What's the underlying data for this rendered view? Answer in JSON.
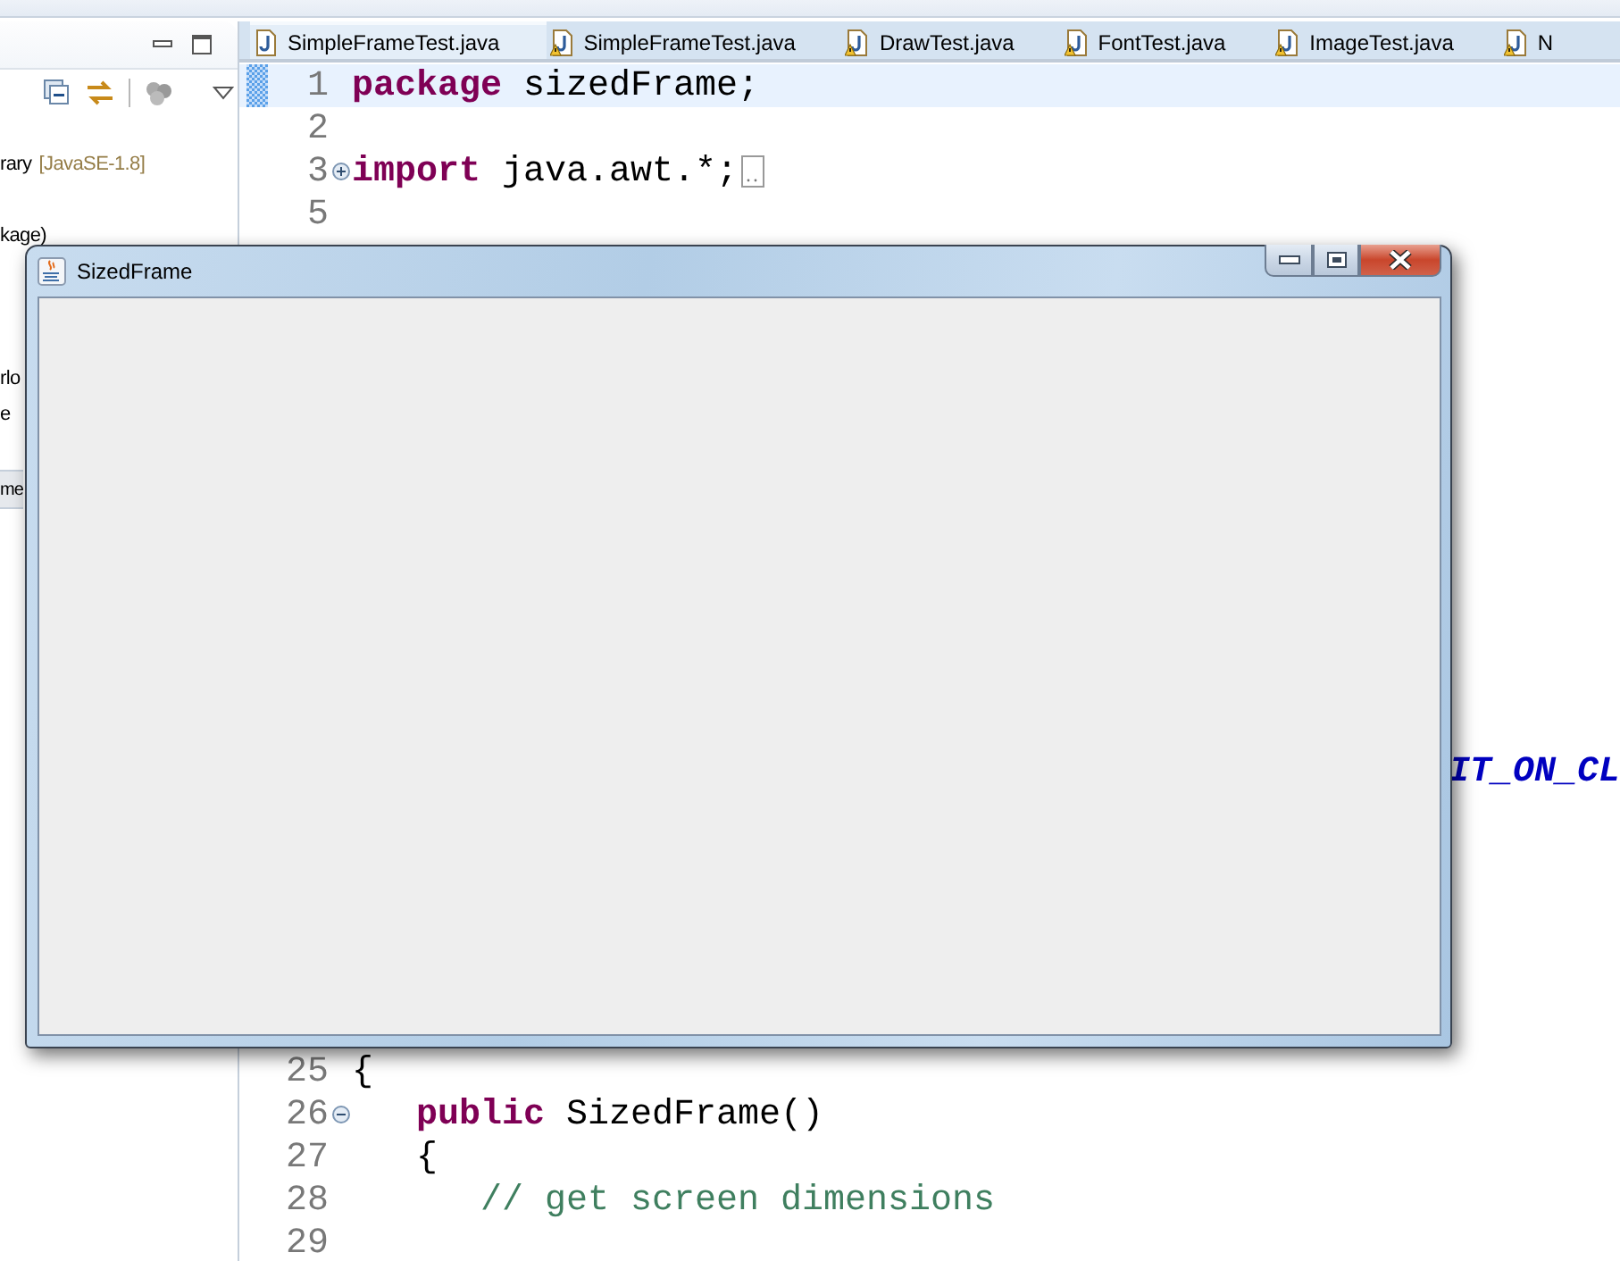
{
  "left_panel": {
    "items": [
      {
        "label": "rary",
        "decoration": "[JavaSE-1.8]"
      },
      {
        "label": "kage)"
      },
      {
        "label": "rlo"
      },
      {
        "label": "e"
      }
    ],
    "tab": {
      "label": "me"
    }
  },
  "editor": {
    "tabs": [
      {
        "label": "SimpleFrameTest.java",
        "warning": false,
        "selected": true
      },
      {
        "label": "SimpleFrameTest.java",
        "warning": true,
        "selected": false
      },
      {
        "label": "DrawTest.java",
        "warning": true,
        "selected": false
      },
      {
        "label": "FontTest.java",
        "warning": true,
        "selected": false
      },
      {
        "label": "ImageTest.java",
        "warning": true,
        "selected": false
      },
      {
        "label": "N",
        "warning": true,
        "selected": false
      }
    ],
    "lines": [
      {
        "kind": "code",
        "number": "1",
        "current": true,
        "segments": [
          {
            "kind": "keyword",
            "text": "package"
          },
          {
            "kind": "plain",
            "text": " sizedFrame;"
          }
        ]
      },
      {
        "kind": "code",
        "number": "2",
        "current": false
      },
      {
        "kind": "code",
        "number": "3",
        "current": false,
        "expanded": false,
        "segments": [
          {
            "kind": "keyword",
            "text": "import"
          },
          {
            "kind": "plain",
            "text": " java.awt.*;"
          }
        ]
      },
      {
        "kind": "code",
        "number": "5",
        "current": false
      },
      {
        "kind": "fragment",
        "current": false,
        "segments": [
          {
            "kind": "constant",
            "text": "IT_ON_CL"
          }
        ]
      },
      {
        "kind": "code",
        "number": "25",
        "current": false,
        "segments": [
          {
            "kind": "plain",
            "text": "{"
          }
        ]
      },
      {
        "kind": "code",
        "number": "26",
        "current": false,
        "expanded": true,
        "segments": [
          {
            "kind": "keyword",
            "text": "   public"
          },
          {
            "kind": "plain",
            "text": " SizedFrame()"
          }
        ]
      },
      {
        "kind": "code",
        "number": "27",
        "current": false,
        "segments": [
          {
            "kind": "plain",
            "text": "   {"
          }
        ]
      },
      {
        "kind": "code",
        "number": "28",
        "current": false,
        "segments": [
          {
            "kind": "comment",
            "text": "      // get screen dimensions"
          }
        ]
      },
      {
        "kind": "code",
        "number": "29",
        "current": false
      }
    ]
  },
  "frame_window": {
    "title": "SizedFrame"
  }
}
